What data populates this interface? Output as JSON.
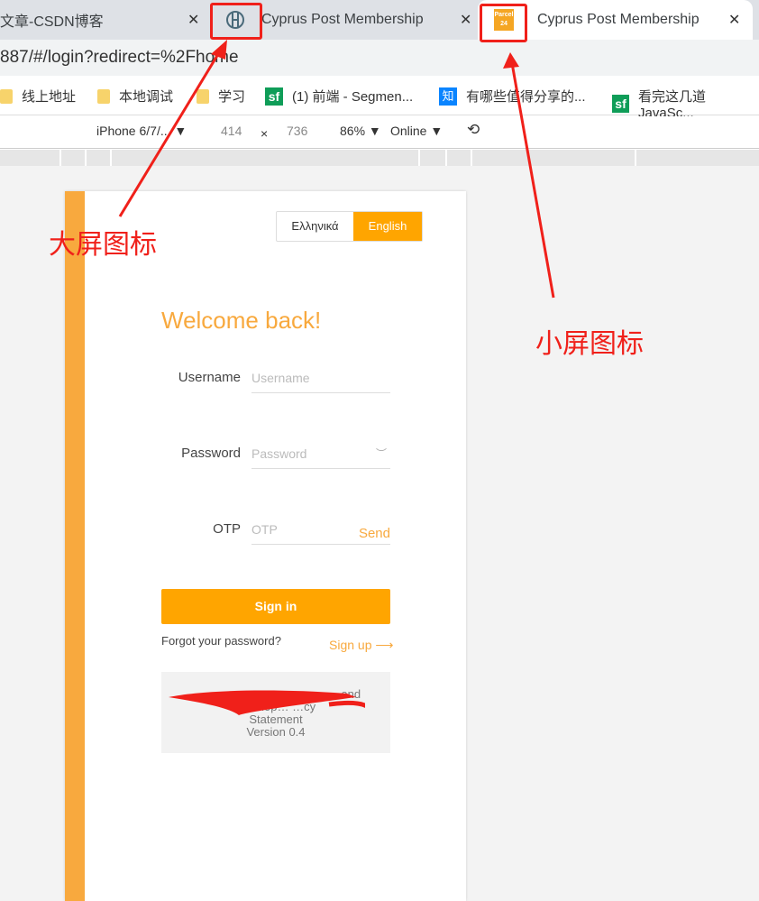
{
  "tabs": [
    {
      "title": "文章-CSDN博客",
      "close": "✕"
    },
    {
      "title": "Cyprus Post Membership",
      "close": "✕",
      "icon": "cyprus-post-logo-icon"
    },
    {
      "title": "Cyprus Post Membership",
      "close": "✕",
      "icon": "parcel24-icon",
      "favicon_text": "Parcel 24",
      "active": true
    }
  ],
  "address": "887/#/login?redirect=%2Fhome",
  "bookmarks": [
    {
      "label": "线上地址",
      "icon": "folder-icon"
    },
    {
      "label": "本地调试",
      "icon": "folder-icon"
    },
    {
      "label": "学习",
      "icon": "folder-icon"
    },
    {
      "label": "(1) 前端 - Segmen...",
      "icon": "sf",
      "badge": "sf"
    },
    {
      "label": "有哪些值得分享的...",
      "icon": "zhihu",
      "badge": "知"
    },
    {
      "label": "看完这几道 JavaSc...",
      "icon": "sf",
      "badge": "sf"
    }
  ],
  "devtools": {
    "device": "iPhone 6/7/... ▼",
    "width": "414",
    "times": "×",
    "height": "736",
    "zoom": "86% ▼",
    "network": "Online ▼"
  },
  "page": {
    "lang": [
      "Ελληνικά",
      "English"
    ],
    "welcome": "Welcome back!",
    "username_label": "Username",
    "username_placeholder": "Username",
    "password_label": "Password",
    "password_placeholder": "Password",
    "otp_label": "OTP",
    "otp_placeholder": "OTP",
    "send": "Send",
    "signin": "Sign in",
    "forgot": "Forgot your password?",
    "signup": "Sign up ⟶",
    "footer_line1": "… and",
    "footer_line2": "develop… …cy",
    "footer_line3": "Statement",
    "version": "Version 0.4"
  },
  "annotations": {
    "large_icon": "大屏图标",
    "small_icon": "小屏图标",
    "color": "#f0201a"
  },
  "accent": "#ffa500"
}
